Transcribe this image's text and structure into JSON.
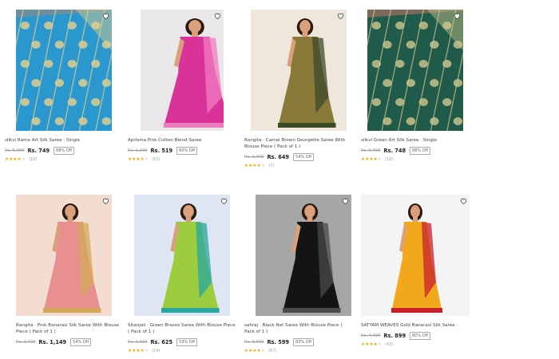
{
  "colors": {
    "accent_star": "#f0a500",
    "price_text": "#222222",
    "mrp_text": "#999999"
  },
  "products": [
    {
      "title": "silkvi Rama Art Silk Saree · Single",
      "mrp": "Rs. 5,999",
      "price": "Rs. 749",
      "discount": "88% Off",
      "rating": 4,
      "reviews": "(10)",
      "image": {
        "kind": "fabric",
        "bg": "#6b8f9e",
        "main": "#2a97cf",
        "accent": "#e7d18b"
      }
    },
    {
      "title": "Aprisma Pink Cotton Blend Saree",
      "mrp": "Rs. 1,299",
      "price": "Rs. 519",
      "discount": "60% Off",
      "rating": 4,
      "reviews": "(51)",
      "image": {
        "kind": "model",
        "bg": "#e9e7ea",
        "main": "#d9339a",
        "accent": "#f07cc0"
      }
    },
    {
      "title": "Rangita · Camel Brown Georgette Saree With Blouse Piece ( Pack of 1 )",
      "mrp": "Rs. 1,399",
      "price": "Rs. 649",
      "discount": "54% Off",
      "rating": 4,
      "reviews": "(7)",
      "image": {
        "kind": "model",
        "bg": "#efe6dc",
        "main": "#8a7a3a",
        "accent": "#3d4a2a"
      }
    },
    {
      "title": "silkvi Green Art Silk Saree · Single",
      "mrp": "Rs. 5,999",
      "price": "Rs. 748",
      "discount": "88% Off",
      "rating": 4,
      "reviews": "(10)",
      "image": {
        "kind": "fabric",
        "bg": "#7b6a5a",
        "main": "#1f5a4a",
        "accent": "#cfc78e"
      }
    },
    {
      "title": "Rangita · Pink Banarasi Silk Saree With Blouse Piece ( Pack of 1 )",
      "mrp": "Rs. 2,499",
      "price": "Rs. 1,149",
      "discount": "54% Off",
      "rating": 0,
      "reviews": "",
      "image": {
        "kind": "model",
        "bg": "#f2ddd0",
        "main": "#e88f8f",
        "accent": "#d4a85a"
      }
    },
    {
      "title": "Sitanjali · Green Brasso Saree With Blouse Piece ( Pack of 1 )",
      "mrp": "Rs. 1,319",
      "price": "Rs. 625",
      "discount": "53% Off",
      "rating": 4,
      "reviews": "(14)",
      "image": {
        "kind": "model",
        "bg": "#dfe5f2",
        "main": "#9ccd3f",
        "accent": "#2aa6a0"
      }
    },
    {
      "title": "sahraj · Black Net Saree With Blouse Piece ( Pack of 1 )",
      "mrp": "Rs. 3,699",
      "price": "Rs. 599",
      "discount": "83% Off",
      "rating": 4,
      "reviews": "(67)",
      "image": {
        "kind": "model",
        "bg": "#a6a6a6",
        "main": "#141414",
        "accent": "#4a4a4a"
      }
    },
    {
      "title": "SATYAM WEAVES Gold Banarasi Silk Saree ·",
      "mrp": "Rs. 4,499",
      "price": "Rs. 899",
      "discount": "80% Off",
      "rating": 4,
      "reviews": "(43)",
      "image": {
        "kind": "model",
        "bg": "#f4f4f4",
        "main": "#f2a81c",
        "accent": "#c8202a"
      }
    }
  ]
}
